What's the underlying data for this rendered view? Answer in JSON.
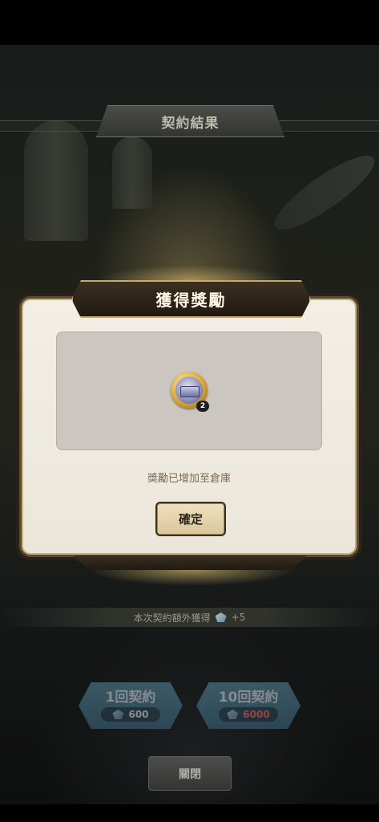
{
  "contract_title": "契約結果",
  "dialog": {
    "title": "獲得獎勵",
    "reward_count": "2",
    "note": "獎勵已增加至倉庫",
    "confirm_label": "確定"
  },
  "extra_reward": {
    "text": "本次契約額外獲得",
    "amount": "+5",
    "icon": "gem-icon"
  },
  "draw_buttons": [
    {
      "label": "1回契約",
      "cost": "600",
      "cost_color": "#eaeaea"
    },
    {
      "label": "10回契約",
      "cost": "6000",
      "cost_color": "#ff6a6a"
    }
  ],
  "close_label": "關閉"
}
